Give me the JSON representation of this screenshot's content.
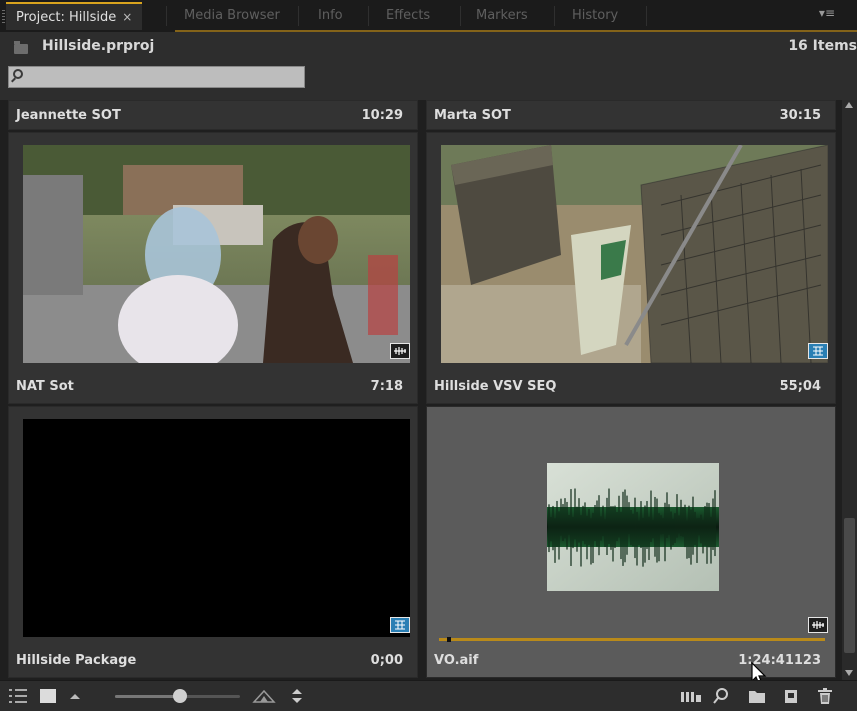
{
  "tabs": [
    {
      "label": "Project: Hillside",
      "active": true,
      "closable": true
    },
    {
      "label": "Media Browser",
      "active": false
    },
    {
      "label": "Info",
      "active": false
    },
    {
      "label": "Effects",
      "active": false
    },
    {
      "label": "Markers",
      "active": false
    },
    {
      "label": "History",
      "active": false
    }
  ],
  "close_glyph": "×",
  "panel_menu_glyph": "▾≡",
  "header": {
    "project_name": "Hillside.prproj",
    "item_count": "16 Items",
    "search_placeholder": "",
    "search_value": ""
  },
  "items": [
    {
      "name": "Jeannette SOT",
      "duration": "10:29"
    },
    {
      "name": "Marta SOT",
      "duration": "30:15"
    },
    {
      "name": "NAT Sot",
      "duration": "7:18",
      "badge": "audio-video-icon"
    },
    {
      "name": "Hillside VSV SEQ",
      "duration": "55;04",
      "badge": "sequence-icon"
    },
    {
      "name": "Hillside Package",
      "duration": "0;00",
      "badge": "sequence-icon"
    },
    {
      "name": "VO.aif",
      "duration": "1:24:41123",
      "badge": "audio-video-icon",
      "selected": true,
      "playhead_progress": 0.02
    }
  ],
  "colors": {
    "accent": "#d9a41e",
    "selected_cell": "#5b5b5b",
    "sequence_badge": "#2a7fb4"
  },
  "toolbar": {
    "icons": [
      "list-view-icon",
      "icon-view-icon",
      "zoom-out-icon",
      "zoom-slider",
      "zoom-in-icon",
      "sort-icon",
      "automate-to-sequence-icon",
      "find-icon",
      "new-bin-icon",
      "new-item-icon",
      "delete-icon"
    ],
    "zoom_level": 0.52
  }
}
